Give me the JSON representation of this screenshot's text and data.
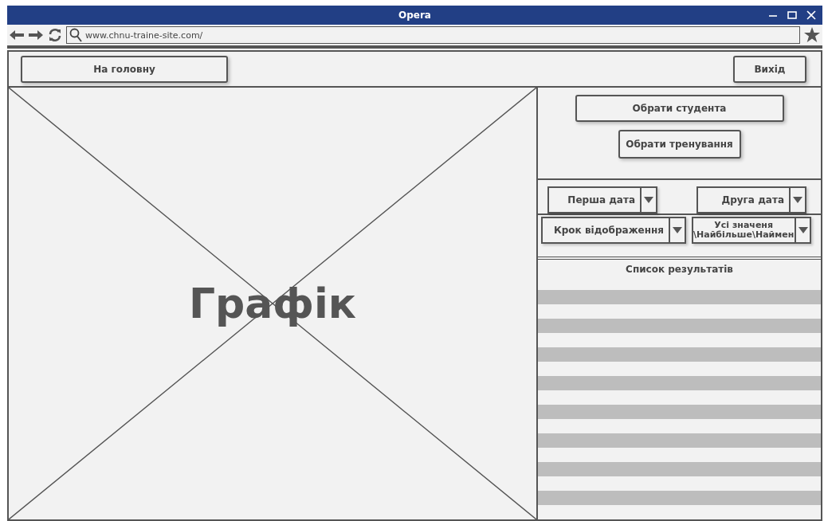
{
  "window": {
    "title": "Opera"
  },
  "address_bar": {
    "url": "www.chnu-traine-site.com/"
  },
  "header": {
    "home_button": "На головну",
    "exit_button": "Вихід"
  },
  "chart_placeholder": {
    "label": "Графік"
  },
  "selection": {
    "buttons": [
      "Обрати студента",
      "Обрати тренування"
    ]
  },
  "filters": [
    {
      "label": "Перша дата"
    },
    {
      "label": "Друга дата"
    },
    {
      "label": "Крок відображення"
    },
    {
      "label": "Усі значеня \\Найбільше\\Наймен"
    }
  ],
  "results": {
    "title": "Список результатів"
  }
}
